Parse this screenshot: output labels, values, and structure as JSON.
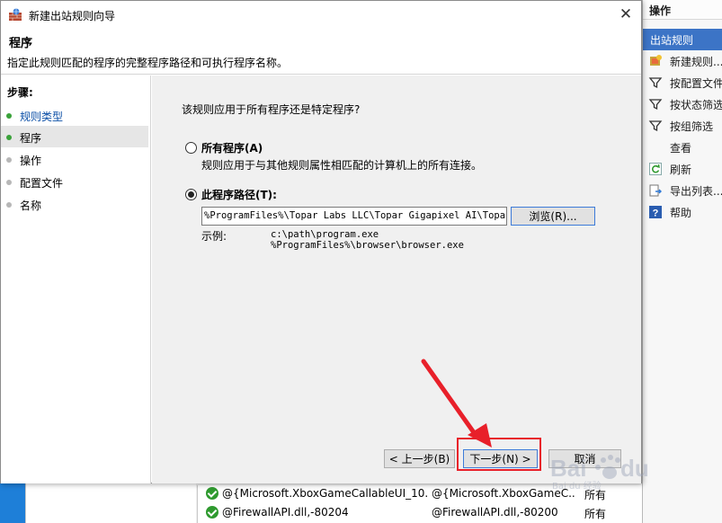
{
  "dialog": {
    "title": "新建出站规则向导",
    "close_glyph": "✕",
    "header_title": "程序",
    "header_desc": "指定此规则匹配的程序的完整程序路径和可执行程序名称。"
  },
  "steps": {
    "title": "步骤:",
    "items": [
      {
        "label": "规则类型",
        "state": "done"
      },
      {
        "label": "程序",
        "state": "current"
      },
      {
        "label": "操作",
        "state": "pending"
      },
      {
        "label": "配置文件",
        "state": "pending"
      },
      {
        "label": "名称",
        "state": "pending"
      }
    ]
  },
  "content": {
    "question": "该规则应用于所有程序还是特定程序?",
    "option_all": {
      "label": "所有程序(A)",
      "desc": "规则应用于与其他规则属性相匹配的计算机上的所有连接。",
      "selected": false
    },
    "option_path": {
      "label": "此程序路径(T):",
      "selected": true
    },
    "path_value": "%ProgramFiles%\\Topar Labs LLC\\Topar Gigapixel AI\\Topar Gigapixel AI.exe",
    "browse_label": "浏览(R)...",
    "example_label": "示例:",
    "example_lines": [
      "c:\\path\\program.exe",
      "%ProgramFiles%\\browser\\browser.exe"
    ]
  },
  "buttons": {
    "back": "< 上一步(B)",
    "next": "下一步(N) >",
    "cancel": "取消"
  },
  "actions": {
    "title": "操作",
    "selected": "出站规则",
    "items": [
      {
        "label": "新建规则...",
        "icon": "new-rule-icon"
      },
      {
        "label": "按配置文件筛选",
        "icon": "filter-icon"
      },
      {
        "label": "按状态筛选",
        "icon": "filter-icon"
      },
      {
        "label": "按组筛选",
        "icon": "filter-icon"
      },
      {
        "label": "查看",
        "icon": ""
      },
      {
        "label": "刷新",
        "icon": "refresh-icon"
      },
      {
        "label": "导出列表...",
        "icon": "export-icon"
      },
      {
        "label": "帮助",
        "icon": "help-icon"
      }
    ]
  },
  "rules_list": [
    {
      "name": "@{Microsoft.XboxGameCallableUI_10...",
      "group": "@{Microsoft.XboxGameC...",
      "profile": "所有"
    },
    {
      "name": "@FirewallAPI.dll,-80204",
      "group": "@FirewallAPI.dll,-80200",
      "profile": "所有"
    }
  ],
  "watermark": "Bai du 经验",
  "colors": {
    "accent": "#3c74c6",
    "annotation": "#e8202a",
    "step_done": "#3aa23a",
    "link": "#0a4ea6"
  }
}
